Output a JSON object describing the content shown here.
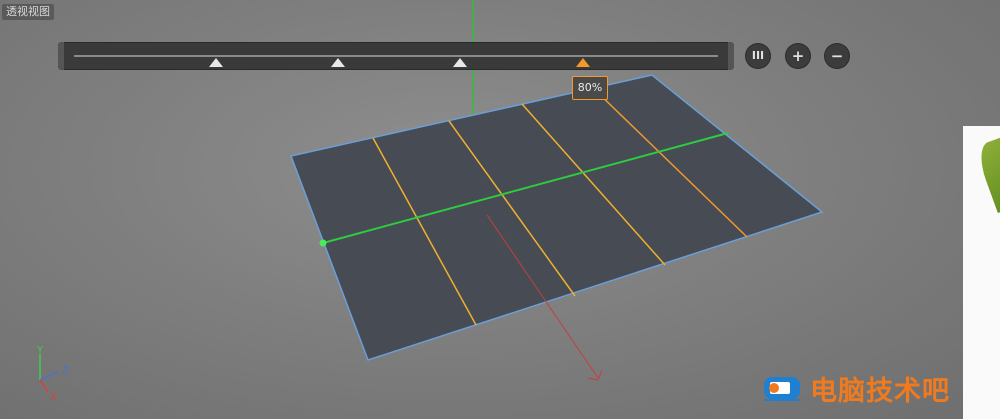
{
  "viewport": {
    "label": "透视视图"
  },
  "slider": {
    "handles": [
      {
        "position": 0.22,
        "active": false
      },
      {
        "position": 0.41,
        "active": false
      },
      {
        "position": 0.6,
        "active": false
      },
      {
        "position": 0.79,
        "active": true
      }
    ],
    "tooltip": "80%",
    "buttons": {
      "pause_label": "III",
      "add_label": "+",
      "remove_label": "−"
    }
  },
  "axes": {
    "y": "Y",
    "z": "Z",
    "x": "X"
  },
  "watermark": {
    "text": "电脑技术吧"
  },
  "colors": {
    "accent_orange": "#f39a2a",
    "grid_yellow": "#f0b030",
    "edge_green": "#2ecc40",
    "plane_fill": "#474b53",
    "plane_border": "#6a9fd8"
  }
}
